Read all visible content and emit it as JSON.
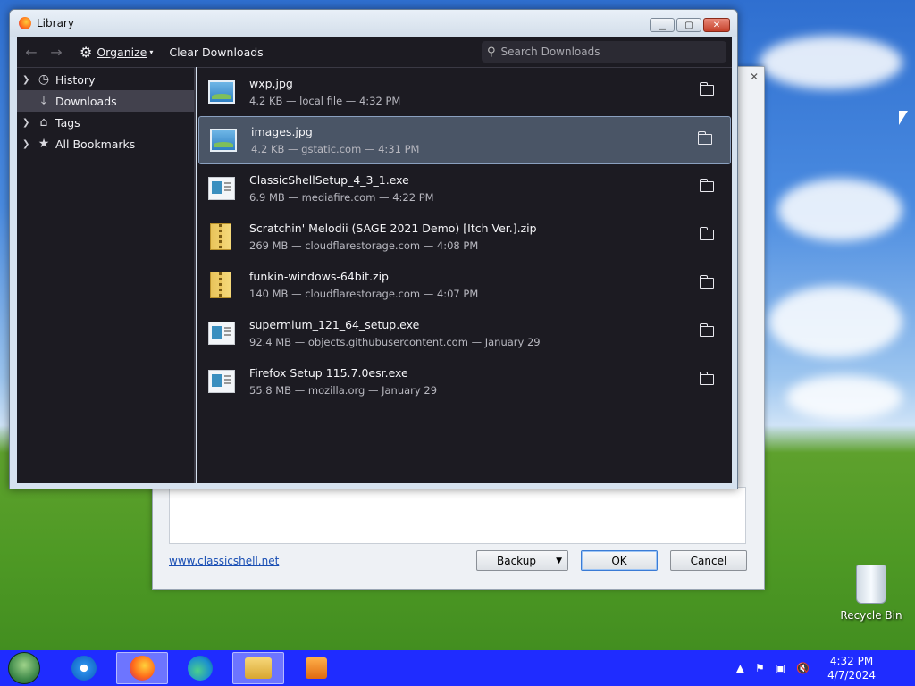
{
  "library": {
    "title": "Library",
    "toolbar": {
      "organize_label": "Organize",
      "clear_label": "Clear Downloads",
      "search_placeholder": "Search Downloads"
    },
    "sidebar": {
      "items": [
        {
          "label": "History",
          "icon": "clock-icon"
        },
        {
          "label": "Downloads",
          "icon": "download-icon"
        },
        {
          "label": "Tags",
          "icon": "tag-icon"
        },
        {
          "label": "All Bookmarks",
          "icon": "star-icon"
        }
      ]
    },
    "downloads": [
      {
        "name": "wxp.jpg",
        "meta": "4.2 KB — local file — 4:32 PM",
        "type": "image"
      },
      {
        "name": "images.jpg",
        "meta": "4.2 KB — gstatic.com — 4:31 PM",
        "type": "image"
      },
      {
        "name": "ClassicShellSetup_4_3_1.exe",
        "meta": "6.9 MB — mediafire.com — 4:22 PM",
        "type": "exe"
      },
      {
        "name": "Scratchin' Melodii (SAGE 2021 Demo) [Itch Ver.].zip",
        "meta": "269 MB — cloudflarestorage.com — 4:08 PM",
        "type": "zip"
      },
      {
        "name": "funkin-windows-64bit.zip",
        "meta": "140 MB — cloudflarestorage.com — 4:07 PM",
        "type": "zip"
      },
      {
        "name": "supermium_121_64_setup.exe",
        "meta": "92.4 MB — objects.githubusercontent.com — January 29",
        "type": "exe"
      },
      {
        "name": "Firefox Setup 115.7.0esr.exe",
        "meta": "55.8 MB — mozilla.org — January 29",
        "type": "exe"
      }
    ]
  },
  "classic_dialog": {
    "link": "www.classicshell.net",
    "backup_label": "Backup",
    "ok_label": "OK",
    "cancel_label": "Cancel"
  },
  "desktop": {
    "recycle_bin_label": "Recycle Bin"
  },
  "taskbar": {
    "time": "4:32 PM",
    "date": "4/7/2024"
  }
}
